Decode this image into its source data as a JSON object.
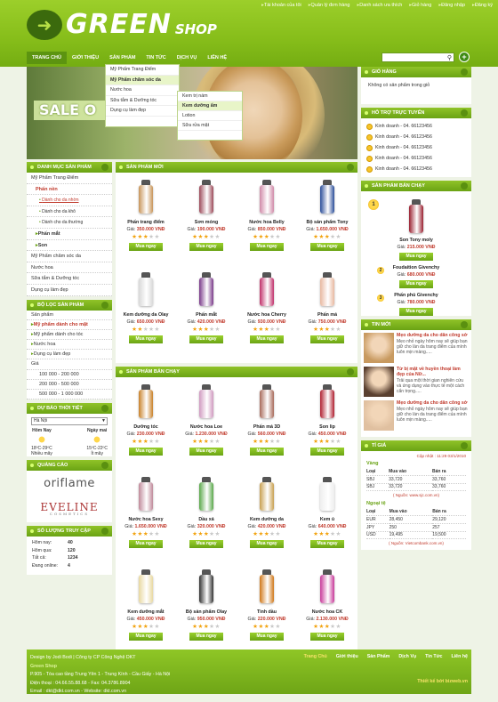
{
  "toplinks": [
    "Tài khoản của tôi",
    "Quản lý đơn hàng",
    "Danh sách ưa thích",
    "Giỏ hàng",
    "Đăng nhập",
    "Đăng ký"
  ],
  "logo": {
    "main": "GREEN",
    "sub": "SHOP"
  },
  "nav": [
    "Trang chủ",
    "Giới thiệu",
    "Sản phẩm",
    "Tin tức",
    "Dịch vụ",
    "Liên hệ"
  ],
  "banner": {
    "sale": "SALE O"
  },
  "dropdown1": [
    "Mỹ Phẩm Trang Điểm",
    "Mỹ Phẩm chăm sóc da",
    "Nước hoa",
    "Sữa tắm & Dưỡng tóc",
    "Dụng cụ làm đẹp"
  ],
  "dropdown2": [
    "Kem trị nám",
    "Kem dưỡng ẩm",
    "Lotion",
    "Sữa rửa mặt"
  ],
  "left": {
    "cat_title": "Danh mục sản phẩm",
    "cats": [
      "Mỹ Phẩm Trang Điểm",
      "Phấn nền",
      "Dành cho da nhờn",
      "Dành cho da khô",
      "Dành cho da thường",
      "Phấn mắt",
      "Son",
      "Mỹ Phẩm chăm sóc da",
      "Nước hoa",
      "Sữa tắm & Dưỡng tóc",
      "Dụng cụ làm đẹp"
    ],
    "filter_title": "Bộ lọc sản phẩm",
    "filter": [
      "Sản phẩm",
      "Mỹ phẩm dành cho mặt",
      "Mỹ phẩm dành cho tóc",
      "Nước hoa",
      "Dụng cụ làm đẹp",
      "Giá",
      "100 000 - 200 000",
      "200 000 - 500 000",
      "500 000 - 1 000 000"
    ],
    "weather_title": "Dự báo thời tiết",
    "weather_city": "Hà Nội",
    "weather": [
      {
        "day": "Hôm Nay",
        "temp": "18ºC-29ºC",
        "desc": "Nhiều mây"
      },
      {
        "day": "Ngày mai",
        "temp": "15ºC-22ºC",
        "desc": "Ít mây"
      }
    ],
    "ad_title": "Quảng cáo",
    "ad1": "oriflame",
    "ad2": "EVELINE",
    "ad2_sub": "COSMETICS",
    "stats_title": "Số lượng truy cập",
    "stats": [
      {
        "k": "Hôm nay:",
        "v": "40"
      },
      {
        "k": "Hôm qua:",
        "v": "120"
      },
      {
        "k": "Tất cả:",
        "v": "1234"
      },
      {
        "k": "Đang online:",
        "v": "4"
      }
    ]
  },
  "new_title": "Sản phẩm mới",
  "best_title": "Sản phẩm bán chạy",
  "buy_label": "Mua ngay",
  "price_label": "Giá:",
  "new_products": [
    {
      "name": "Phấn trang điểm",
      "price": "350.000 VNĐ",
      "stars": 3,
      "color": "#c8955a"
    },
    {
      "name": "Sơn móng",
      "price": "190.000 VNĐ",
      "stars": 3,
      "color": "#9c4a5a"
    },
    {
      "name": "Nước hoa Belly",
      "price": "850.000 VNĐ",
      "stars": 3,
      "color": "#d08aa8"
    },
    {
      "name": "Bộ sản phẩm Tony",
      "price": "1.650.000 VNĐ",
      "stars": 3,
      "color": "#2b4e9a"
    },
    {
      "name": "Kem dưỡng da Olay",
      "price": "650.000 VNĐ",
      "stars": 2,
      "color": "#d8d8d8"
    },
    {
      "name": "Phấn mắt",
      "price": "420.000 VNĐ",
      "stars": 3,
      "color": "#7a3a8a"
    },
    {
      "name": "Nước hoa Cherry",
      "price": "930.000 VNĐ",
      "stars": 3,
      "color": "#c0306a"
    },
    {
      "name": "Phấn má",
      "price": "750.000 VNĐ",
      "stars": 3,
      "color": "#e8b8a0"
    }
  ],
  "best_products": [
    {
      "name": "Dưỡng tóc",
      "price": "230.000 VNĐ",
      "stars": 3,
      "color": "#c9822a"
    },
    {
      "name": "Nước hoa Loe",
      "price": "1.230.000 VNĐ",
      "stars": 3,
      "color": "#d09ac0"
    },
    {
      "name": "Phấn má 3D",
      "price": "560.000 VNĐ",
      "stars": 3,
      "color": "#a86a5a"
    },
    {
      "name": "Son lip",
      "price": "450.000 VNĐ",
      "stars": 3,
      "color": "#b02030"
    },
    {
      "name": "Nước hoa Sexy",
      "price": "1.650.000 VNĐ",
      "stars": 3,
      "color": "#c08a9a"
    },
    {
      "name": "Dầu xả",
      "price": "320.000 VNĐ",
      "stars": 3,
      "color": "#5aa84a"
    },
    {
      "name": "Kem dưỡng da",
      "price": "420.000 VNĐ",
      "stars": 3,
      "color": "#c8a050"
    },
    {
      "name": "Kem ủ",
      "price": "640.000 VNĐ",
      "stars": 3,
      "color": "#eeeeee"
    },
    {
      "name": "Kem dưỡng mắt",
      "price": "450.000 VNĐ",
      "stars": 3,
      "color": "#e8d8a0"
    },
    {
      "name": "Bộ sản phẩm Olay",
      "price": "950.000 VNĐ",
      "stars": 3,
      "color": "#333333"
    },
    {
      "name": "Tinh dầu",
      "price": "220.000 VNĐ",
      "stars": 3,
      "color": "#d0781a"
    },
    {
      "name": "Nước hoa CK",
      "price": "2.130.000 VNĐ",
      "stars": 3,
      "color": "#c83a9a"
    }
  ],
  "right": {
    "cart_title": "Giỏ hàng",
    "cart_empty": "Không có sản phẩm trong giỏ",
    "support_title": "Hỗ trợ trực tuyến",
    "support": [
      "Kinh doanh - 04. 66123456",
      "Kinh doanh - 04. 66123456",
      "Kinh doanh - 04. 66123456",
      "Kinh doanh - 04. 66123456",
      "Kinh doanh - 04. 66123456"
    ],
    "best_title": "Sản phẩm bán chạy",
    "best": [
      {
        "rank": "1",
        "name": "Son Tony moly",
        "price": "215.000 VNĐ",
        "color": "#9a2030"
      },
      {
        "rank": "2",
        "name": "Foudaition Givenchy",
        "price": "680.000 VNĐ",
        "color": "#d0a070"
      },
      {
        "rank": "3",
        "name": "Phấn phủ Givenchy",
        "price": "780.000 VNĐ",
        "color": "#c0a080"
      }
    ],
    "news_title": "Tin mới",
    "news": [
      {
        "title": "Mẹo dưỡng da cho dân công sở",
        "desc": "Mẹo nhỏ ngày hôm nay sẽ giúp bạn giữ cho làn da trang điểm của mình luôn mịn màng.....",
        "color": "#c89a60"
      },
      {
        "title": "Từ bị mật về huyền thoại làm đẹp của Nữ...",
        "desc": "Trải qua một thời gian nghiên cứu và ứng dụng vào thực tế một cách cẩn trọng.....",
        "color": "#5a4030"
      },
      {
        "title": "Mẹo dưỡng da cho dân công sở",
        "desc": "Mẹo nhỏ ngày hôm nay sẽ giúp bạn giữ cho làn da trang điểm của mình luôn mịn màng.....",
        "color": "#e0c0a0"
      }
    ],
    "rate_title": "Tỉ giá",
    "rate_updated": "Cập nhật : 11:29 03/1/2010",
    "gold_title": "Vàng",
    "gold_head": [
      "Loại",
      "Mua vào",
      "Bán ra"
    ],
    "gold": [
      [
        "SBJ",
        "33,720",
        "33,760"
      ],
      [
        "SBJ",
        "33,720",
        "33,760"
      ]
    ],
    "gold_src": "( Nguồn: www.sjc.com.vn)",
    "fx_title": "Ngoại tệ",
    "fx_head": [
      "Loại",
      "Mua vào",
      "Bán ra"
    ],
    "fx": [
      [
        "EUR",
        "28,450",
        "29,120"
      ],
      [
        "JPY",
        "250",
        "257"
      ],
      [
        "USD",
        "19,495",
        "19,500"
      ]
    ],
    "fx_src": "( Nguồn: Vietcombank.com.vn)"
  },
  "footer": {
    "design": "Design by Jodi Bodi",
    "company": "Công ty CP Công Nghệ DKT",
    "shop": "Green Shop",
    "addr": "P.905 - Tòa cao tầng Trung Yên 1 - Trung Kính - Cầu Giấy - Hà Nội",
    "phone": "Điện thoại : 04.66.55.88.68 - Fax: 04.3786.8904",
    "email": "Email : dkt@dkt.com.vn  -  Website: dkt.com.vn",
    "links": [
      "Trang Chủ",
      "Giới thiệu",
      "Sản Phẩm",
      "Dịch Vụ",
      "Tin Tức",
      "Liên hệ"
    ],
    "designer": "Thiết kế bởi bizweb.vn"
  }
}
